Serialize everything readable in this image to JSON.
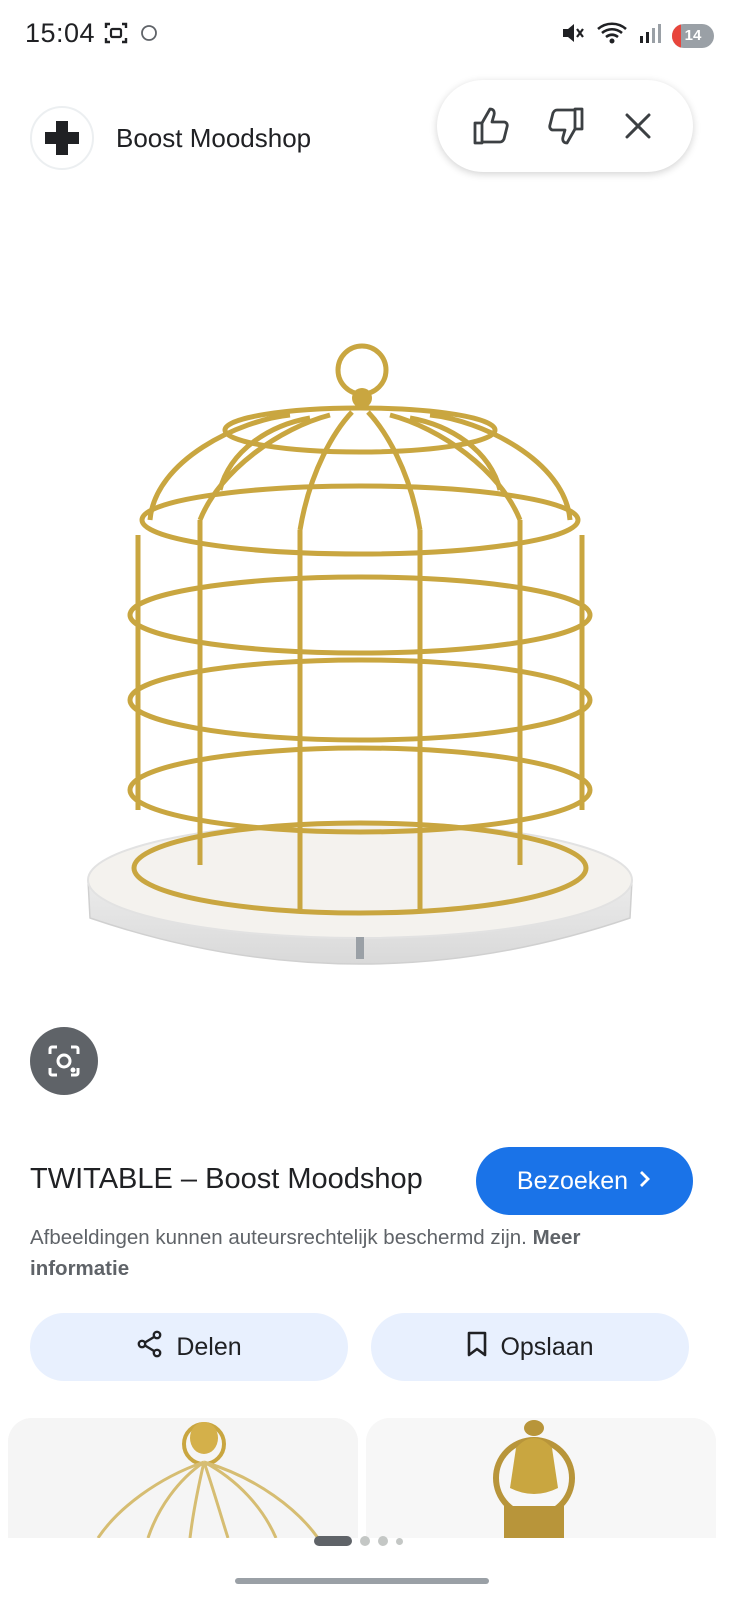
{
  "status_bar": {
    "time": "15:04",
    "battery_level": "14",
    "icons": [
      "screenshot-icon",
      "circle-icon",
      "mute-icon",
      "wifi-icon",
      "signal-icon",
      "battery-icon"
    ]
  },
  "site": {
    "name": "Boost Moodshop",
    "logo_icon": "plus-cross-icon"
  },
  "feedback": {
    "thumbs_up_icon": "thumbs-up-icon",
    "thumbs_down_icon": "thumbs-down-icon",
    "close_icon": "close-icon"
  },
  "result": {
    "title": "TWITABLE – Boost Moodshop",
    "visit_label": "Bezoeken",
    "copyright_text": "Afbeeldingen kunnen auteursrechtelijk beschermd zijn.",
    "more_info_label": "Meer informatie"
  },
  "actions": {
    "share_label": "Delen",
    "save_label": "Opslaan"
  },
  "colors": {
    "accent": "#1a73e8",
    "chip_bg": "#e8f0fe",
    "gold": "#c9a640"
  }
}
